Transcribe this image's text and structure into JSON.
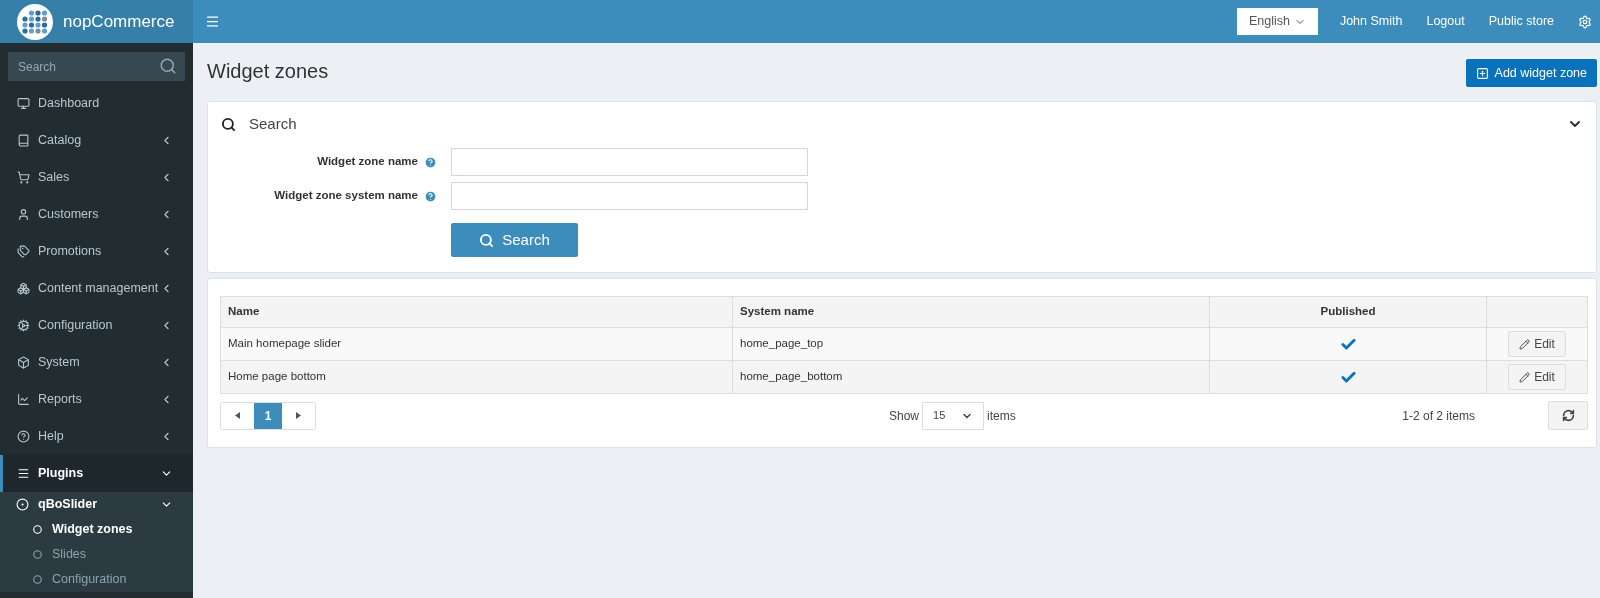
{
  "header": {
    "logo_text": "nopCommerce",
    "language": "English",
    "user": "John Smith",
    "links": [
      "Logout",
      "Public store"
    ]
  },
  "sidebar": {
    "search": {
      "placeholder": "Search"
    },
    "items": [
      {
        "label": "Dashboard",
        "kind": "link",
        "selected": false
      },
      {
        "label": "Catalog",
        "kind": "menu",
        "selected": false,
        "expanded": false
      },
      {
        "label": "Sales",
        "kind": "menu",
        "selected": false,
        "expanded": false
      },
      {
        "label": "Customers",
        "kind": "menu",
        "selected": false,
        "expanded": false
      },
      {
        "label": "Promotions",
        "kind": "menu",
        "selected": false,
        "expanded": false
      },
      {
        "label": "Content management",
        "kind": "menu",
        "selected": false,
        "expanded": false
      },
      {
        "label": "Configuration",
        "kind": "menu",
        "selected": false,
        "expanded": false
      },
      {
        "label": "System",
        "kind": "menu",
        "selected": false,
        "expanded": false
      },
      {
        "label": "Reports",
        "kind": "menu",
        "selected": false,
        "expanded": false
      },
      {
        "label": "Help",
        "kind": "menu",
        "selected": false,
        "expanded": false
      },
      {
        "label": "Plugins",
        "kind": "menu",
        "selected": true,
        "expanded": true,
        "children": [
          {
            "label": "qBoSlider",
            "expanded": true,
            "children": [
              {
                "label": "Widget zones",
                "selected": true
              },
              {
                "label": "Slides",
                "selected": false
              },
              {
                "label": "Configuration",
                "selected": false
              }
            ]
          }
        ]
      }
    ]
  },
  "page": {
    "title": "Widget zones",
    "add_button": "Add widget zone"
  },
  "search_panel": {
    "title": "Search",
    "expanded": true,
    "fields": [
      {
        "label": "Widget zone name"
      },
      {
        "label": "Widget zone system name"
      }
    ],
    "button": "Search"
  },
  "table": {
    "columns": [
      "Name",
      "System name",
      "Published"
    ],
    "rows": [
      {
        "name": "Main homepage slider",
        "system_name": "home_page_top",
        "published": true,
        "action": "Edit"
      },
      {
        "name": "Home page bottom",
        "system_name": "home_page_bottom",
        "published": true,
        "action": "Edit"
      }
    ],
    "pagination": {
      "pages": [
        {
          "label": "1",
          "selected": true
        }
      ]
    },
    "page_size": {
      "before": "Show",
      "value": "15",
      "after": "items"
    },
    "summary": "1-2 of 2 items"
  }
}
